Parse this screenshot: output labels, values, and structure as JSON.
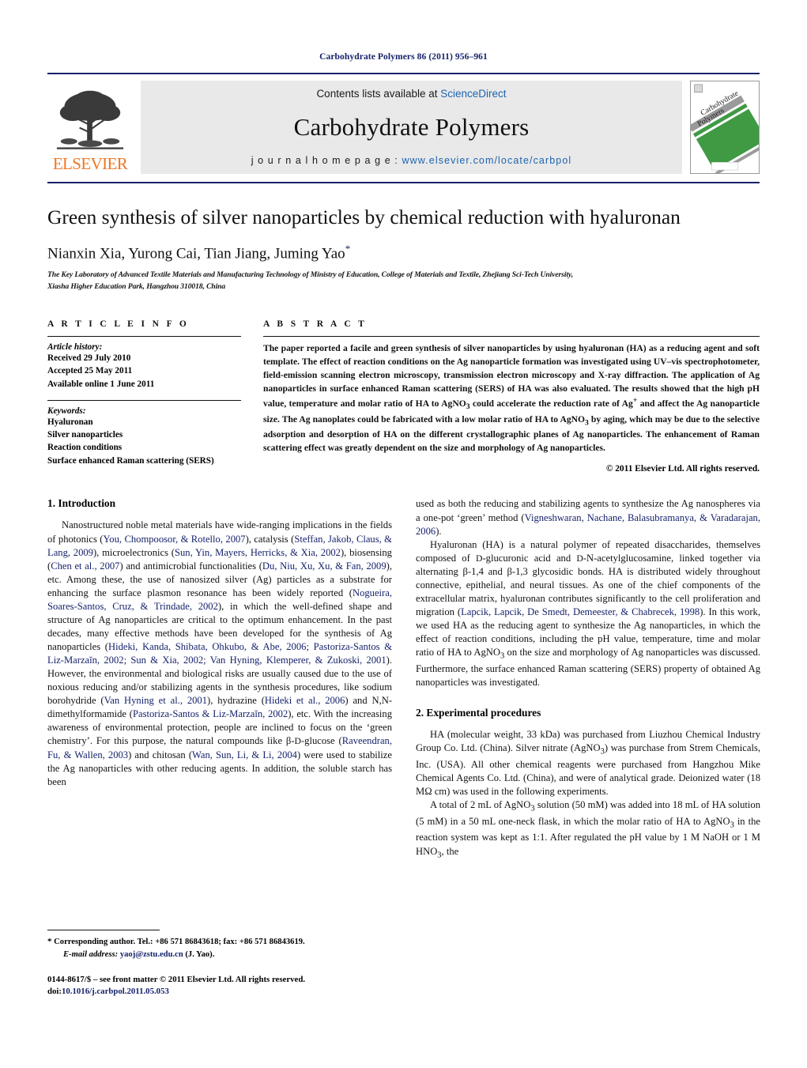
{
  "running_head": "Carbohydrate Polymers 86 (2011) 956–961",
  "masthead": {
    "publisher_name": "ELSEVIER",
    "contents_prefix": "Contents lists available at ",
    "contents_link": "ScienceDirect",
    "journal_name": "Carbohydrate Polymers",
    "homepage_prefix": "j o u r n a l   h o m e p a g e :  ",
    "homepage_url": "www.elsevier.com/locate/carbpol",
    "cover_title_line1": "Carbohydrate",
    "cover_title_line2": "Polymers"
  },
  "article": {
    "title": "Green synthesis of silver nanoparticles by chemical reduction with hyaluronan",
    "authors": "Nianxin Xia, Yurong Cai, Tian Jiang, Juming Yao",
    "corresponding_marker": "*",
    "affiliation_line1": "The Key Laboratory of Advanced Textile Materials and Manufacturing Technology of Ministry of Education, College of Materials and Textile, Zhejiang Sci-Tech University,",
    "affiliation_line2": "Xiasha Higher Education Park, Hangzhou 310018, China"
  },
  "info": {
    "heading": "A R T I C L E   I N F O",
    "history_label": "Article history:",
    "history": [
      "Received 29 July 2010",
      "Accepted 25 May 2011",
      "Available online 1 June 2011"
    ],
    "keywords_label": "Keywords:",
    "keywords": [
      "Hyaluronan",
      "Silver nanoparticles",
      "Reaction conditions",
      "Surface enhanced Raman scattering (SERS)"
    ]
  },
  "abstract": {
    "heading": "A B S T R A C T",
    "text_part1": "The paper reported a facile and green synthesis of silver nanoparticles by using hyaluronan (HA) as a reducing agent and soft template. The effect of reaction conditions on the Ag nanoparticle formation was investigated using UV–vis spectrophotometer, field-emission scanning electron microscopy, transmission electron microscopy and X-ray diffraction. The application of Ag nanoparticles in surface enhanced Raman scattering (SERS) of HA was also evaluated. The results showed that the high pH value, temperature and molar ratio of HA to AgNO",
    "sub1": "3",
    "text_part2": " could accelerate the reduction rate of Ag",
    "sup1": "+",
    "text_part3": " and affect the Ag nanoparticle size. The Ag nanoplates could be fabricated with a low molar ratio of HA to AgNO",
    "sub2": "3",
    "text_part4": " by aging, which may be due to the selective adsorption and desorption of HA on the different crystallographic planes of Ag nanoparticles. The enhancement of Raman scattering effect was greatly dependent on the size and morphology of Ag nanoparticles.",
    "copyright": "© 2011 Elsevier Ltd. All rights reserved."
  },
  "sections": {
    "intro_heading": "1.  Introduction",
    "experimental_heading": "2.  Experimental procedures"
  },
  "intro": {
    "p1_a": "Nanostructured noble metal materials have wide-ranging implications in the fields of photonics (",
    "p1_cite1": "You, Chompoosor, & Rotello, 2007",
    "p1_b": "), catalysis (",
    "p1_cite2": "Steffan, Jakob, Claus, & Lang, 2009",
    "p1_c": "), microelectronics (",
    "p1_cite3": "Sun, Yin, Mayers, Herricks, & Xia, 2002",
    "p1_d": "), biosensing (",
    "p1_cite4": "Chen et al., 2007",
    "p1_e": ") and antimicrobial functionalities (",
    "p1_cite5": "Du, Niu, Xu, Xu, & Fan, 2009",
    "p1_f": "), etc. Among these, the use of nanosized silver (Ag) particles as a substrate for enhancing the surface plasmon resonance has been widely reported (",
    "p1_cite6": "Nogueira, Soares-Santos, Cruz, & Trindade, 2002",
    "p1_g": "), in which the well-defined shape and structure of Ag nanoparticles are critical to the optimum enhancement. In the past decades, many effective methods have been developed for the synthesis of Ag nanoparticles (",
    "p1_cite7": "Hideki, Kanda, Shibata, Ohkubo, & Abe, 2006; Pastoriza-Santos & Liz-Marzaĭn, 2002; Sun & Xia, 2002; Van Hyning, Klemperer, & Zukoski, 2001",
    "p1_h": "). However, the environmental and biological risks are usually caused due to the use of noxious reducing and/or stabilizing agents in the synthesis procedures, like sodium borohydride (",
    "p1_cite8": "Van Hyning et al., 2001",
    "p1_i": "), hydrazine (",
    "p1_cite9": "Hideki et al., 2006",
    "p1_j": ") and N,N-dimethylformamide (",
    "p1_cite10": "Pastoriza-Santos & Liz-Marzaĭn, 2002",
    "p1_k": "), etc. With the increasing awareness of environmental protection, people are inclined to focus on the ‘green chemistry’. For this purpose, the natural compounds like β-",
    "p1_sc1": "D",
    "p1_l": "-glucose (",
    "p1_cite11": "Raveendran, Fu, & Wallen, 2003",
    "p1_m": ") and chitosan (",
    "p1_cite12": "Wan, Sun, Li, & Li, 2004",
    "p1_n": ") were used to stabilize the Ag nanoparticles with other reducing agents. In addition, the soluble starch has been used as both the reducing and stabilizing agents to synthesize the Ag nanospheres via a one-pot ‘green’ method (",
    "p1_cite13": "Vigneshwaran, Nachane, Balasubramanya, & Varadarajan, 2006",
    "p1_o": ").",
    "p2_a": "Hyaluronan (HA) is a natural polymer of repeated disaccharides, themselves composed of ",
    "p2_sc1": "D",
    "p2_b": "-glucuronic acid and ",
    "p2_sc2": "D",
    "p2_c": "-N-acetylglucosamine, linked together via alternating β-1,4 and β-1,3 glycosidic bonds. HA is distributed widely throughout connective, epithelial, and neural tissues. As one of the chief components of the extracellular matrix, hyaluronan contributes significantly to the cell proliferation and migration (",
    "p2_cite1": "Lapcik, Lapcik, De Smedt, Demeester, & Chabrecek, 1998",
    "p2_d": "). In this work, we used HA as the reducing agent to synthesize the Ag nanoparticles, in which the effect of reaction conditions, including the pH value, temperature, time and molar ratio of HA to AgNO",
    "p2_sub1": "3",
    "p2_e": " on the size and morphology of Ag nanoparticles was discussed. Furthermore, the surface enhanced Raman scattering (SERS) property of obtained Ag nanoparticles was investigated."
  },
  "experimental": {
    "p1_a": "HA (molecular weight, 33 kDa) was purchased from Liuzhou Chemical Industry Group Co. Ltd. (China). Silver nitrate (AgNO",
    "p1_sub1": "3",
    "p1_b": ") was purchase from Strem Chemicals, Inc. (USA). All other chemical reagents were purchased from Hangzhou Mike Chemical Agents Co. Ltd. (China), and were of analytical grade. Deionized water (18 MΩ cm) was used in the following experiments.",
    "p2_a": "A total of 2 mL of AgNO",
    "p2_sub1": "3",
    "p2_b": " solution (50 mM) was added into 18 mL of HA solution (5 mM) in a 50 mL one-neck flask, in which the molar ratio of HA to AgNO",
    "p2_sub2": "3",
    "p2_c": " in the reaction system was kept as 1:1. After regulated the pH value by 1 M NaOH or 1 M HNO",
    "p2_sub3": "3",
    "p2_d": ", the"
  },
  "footer": {
    "corr_star": "*",
    "corr_text": " Corresponding author. Tel.: +86 571 86843618; fax: +86 571 86843619.",
    "email_label": "E-mail address:",
    "email": "yaoj@zstu.edu.cn",
    "email_suffix": " (J. Yao).",
    "issn_line": "0144-8617/$ – see front matter © 2011 Elsevier Ltd. All rights reserved.",
    "doi_label": "doi:",
    "doi": "10.1016/j.carbpol.2011.05.053"
  },
  "colors": {
    "journal_blue": "#16226b",
    "link_blue": "#1d63b0",
    "elsevier_orange": "#ef7622",
    "masthead_gray": "#e9e9e9"
  }
}
